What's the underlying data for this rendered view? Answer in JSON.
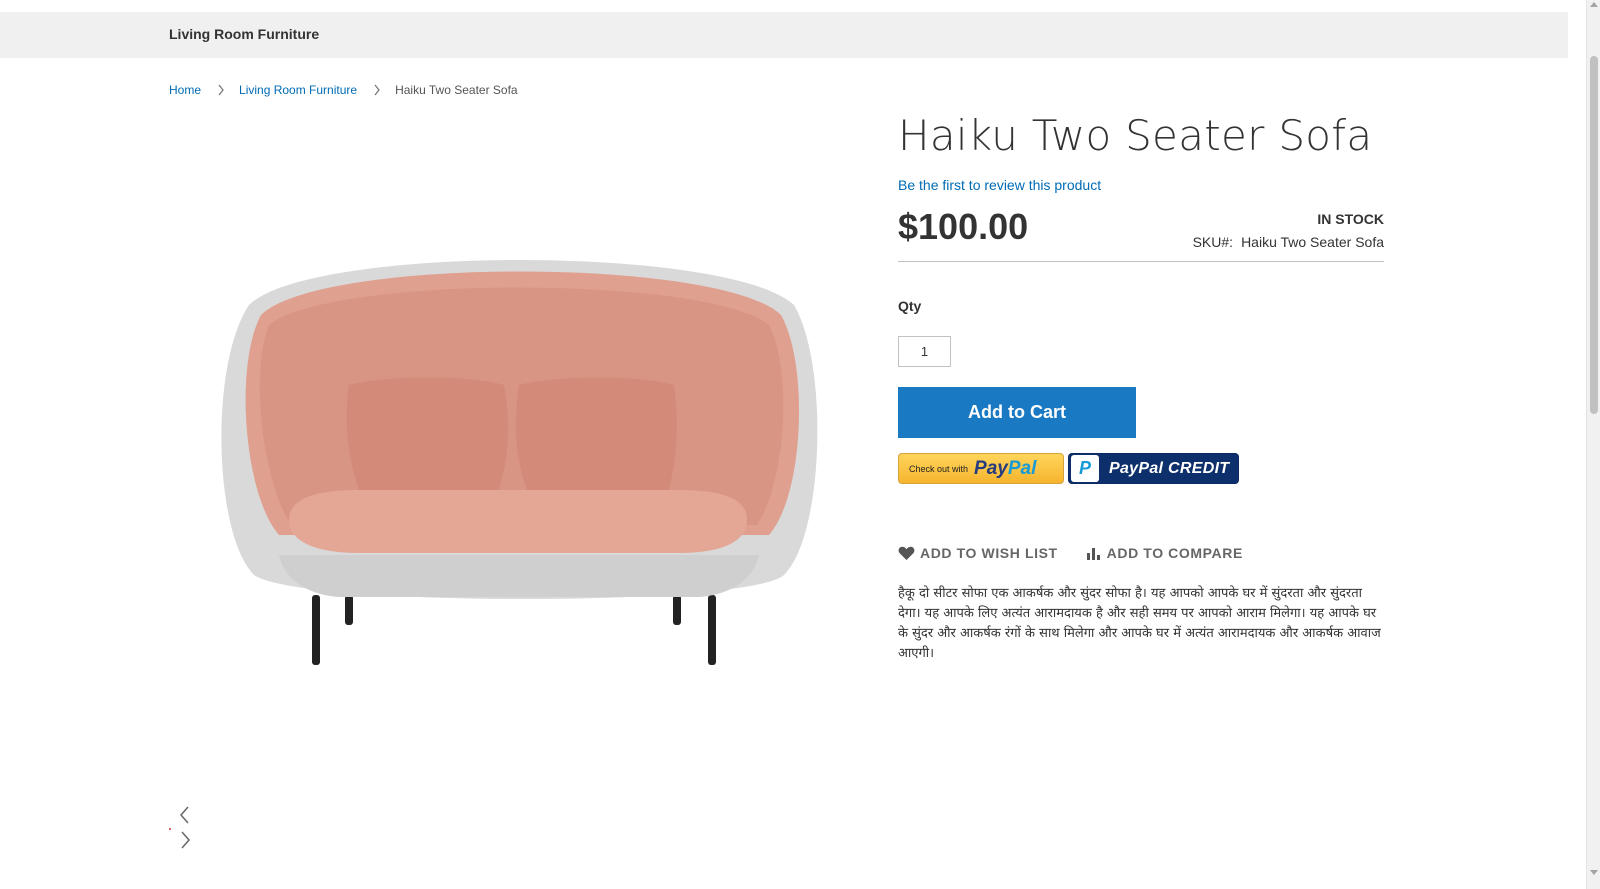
{
  "nav": {
    "category": "Living Room Furniture"
  },
  "breadcrumb": {
    "home": "Home",
    "category": "Living Room Furniture",
    "current": "Haiku Two Seater Sofa"
  },
  "product": {
    "title": "Haiku Two Seater Sofa",
    "review_link": "Be the first to review this product",
    "price": "$100.00",
    "stock": "IN STOCK",
    "sku_label": "SKU#:",
    "sku_value": "Haiku Two Seater Sofa",
    "qty_label": "Qty",
    "qty_value": "1",
    "add_to_cart": "Add to Cart",
    "paypal_checkout_small": "Check out with",
    "paypal_pay": "Pay",
    "paypal_pal": "Pal",
    "paypal_credit_icon": "P",
    "paypal_credit": "PayPal CREDIT",
    "wishlist": "ADD TO WISH LIST",
    "compare": "ADD TO COMPARE",
    "description": "हैकू दो सीटर सोफा एक आकर्षक और सुंदर सोफा है। यह आपको आपके घर में सुंदरता और सुंदरता देगा। यह आपके लिए अत्यंत आरामदायक है और सही समय पर आपको आराम मिलेगा। यह आपके घर के सुंदर और आकर्षक रंगों के साथ मिलेगा और आपके घर में अत्यंत आरामदायक और आकर्षक आवाज आएगी।"
  },
  "icons": {
    "breadcrumb_separator": "chevron-right-icon",
    "wishlist": "heart-icon",
    "compare": "bar-chart-icon",
    "gallery_prev": "chevron-left-icon",
    "gallery_next": "chevron-right-icon"
  },
  "colors": {
    "link": "#006bb4",
    "primary_button": "#1979c3",
    "nav_background": "#f0f0f0",
    "sofa_fabric": "#e0a08f",
    "sofa_shell": "#d9d9d9"
  }
}
